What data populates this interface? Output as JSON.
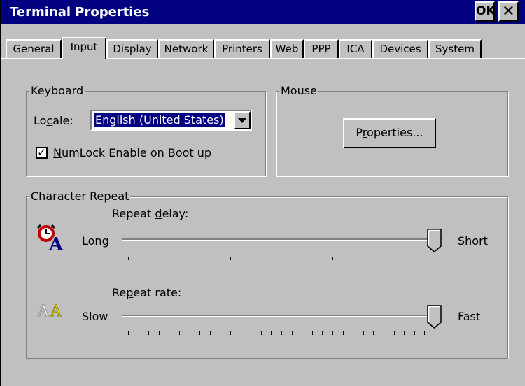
{
  "window": {
    "title": "Terminal Properties",
    "ok_label": "OK",
    "close_label": "✕"
  },
  "tabs": [
    "General",
    "Input",
    "Display",
    "Network",
    "Printers",
    "Web",
    "PPP",
    "ICA",
    "Devices",
    "System"
  ],
  "active_tab": "Input",
  "keyboard": {
    "group_label": "Keyboard",
    "locale_label_pre": "Lo",
    "locale_label_ul": "c",
    "locale_label_post": "ale:",
    "locale_value": "English (United States)",
    "numlock_checked": true,
    "numlock_ul": "N",
    "numlock_post": "umLock Enable on Boot up"
  },
  "mouse": {
    "group_label": "Mouse",
    "properties_pre": "P",
    "properties_ul": "r",
    "properties_post": "operties..."
  },
  "char_repeat": {
    "group_label": "Character Repeat",
    "delay_label_pre": "Repeat ",
    "delay_label_ul": "d",
    "delay_label_post": "elay:",
    "delay_min": "Long",
    "delay_max": "Short",
    "delay_level": 1.0,
    "rate_label_pre": "Re",
    "rate_label_ul": "p",
    "rate_label_post": "eat rate:",
    "rate_min": "Slow",
    "rate_max": "Fast",
    "rate_level": 1.0
  },
  "icons": {
    "delay": "alarm-clock-icon",
    "rate": "double-a-icon"
  },
  "colors": {
    "title_bg": "#000080",
    "face": "#c0c0c0"
  }
}
